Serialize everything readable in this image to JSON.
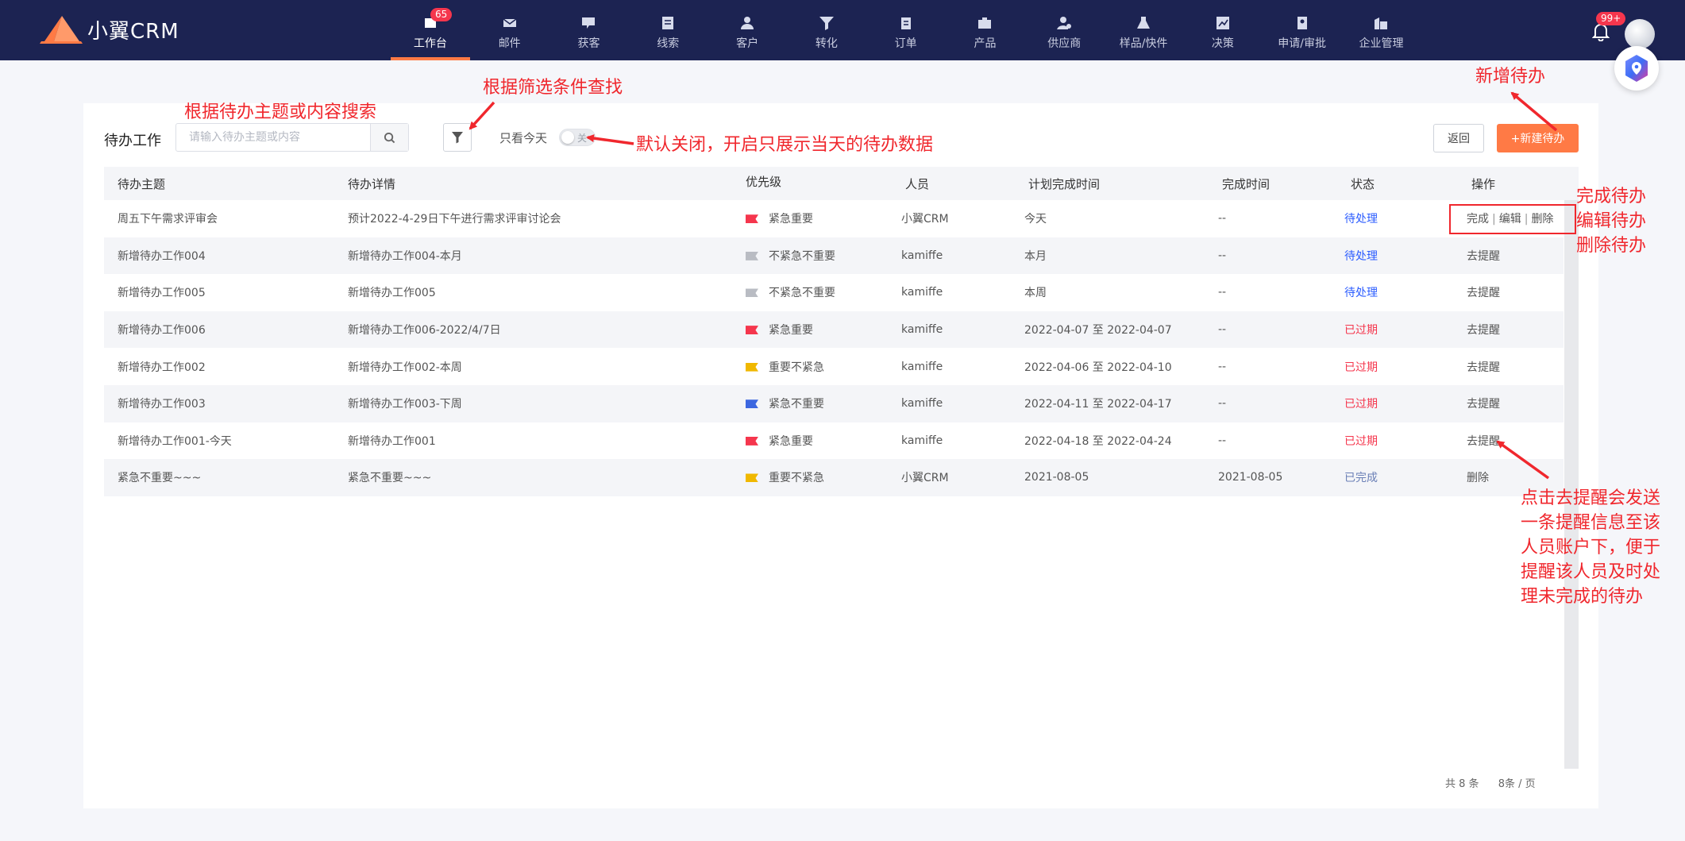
{
  "app": {
    "name": "小翼CRM"
  },
  "nav": {
    "items": [
      {
        "label": "工作台",
        "badge": "65",
        "icon": "workbench-icon",
        "active": true
      },
      {
        "label": "邮件",
        "icon": "mail-icon"
      },
      {
        "label": "获客",
        "icon": "acquire-icon"
      },
      {
        "label": "线索",
        "icon": "lead-icon"
      },
      {
        "label": "客户",
        "icon": "customer-icon"
      },
      {
        "label": "转化",
        "icon": "funnel-icon"
      },
      {
        "label": "订单",
        "icon": "order-icon"
      },
      {
        "label": "产品",
        "icon": "product-icon"
      },
      {
        "label": "供应商",
        "icon": "supplier-icon"
      },
      {
        "label": "样品/快件",
        "icon": "flask-icon"
      },
      {
        "label": "决策",
        "icon": "chart-icon"
      },
      {
        "label": "申请/审批",
        "icon": "approval-icon"
      },
      {
        "label": "企业管理",
        "icon": "building-icon"
      }
    ],
    "notification_badge": "99+"
  },
  "toolbar": {
    "title": "待办工作",
    "search_placeholder": "请输入待办主题或内容",
    "today_only_label": "只看今天",
    "toggle_text": "关",
    "back_label": "返回",
    "new_label": "+新建待办"
  },
  "table": {
    "columns": [
      "待办主题",
      "待办详情",
      "优先级",
      "人员",
      "计划完成时间",
      "完成时间",
      "状态",
      "操作"
    ],
    "rows": [
      {
        "subject": "周五下午需求评审会",
        "detail": "预计2022-4-29日下午进行需求评审讨论会",
        "priority": "紧急重要",
        "flag": "#f5364d",
        "person": "小翼CRM",
        "planned": "今天",
        "done_time": "--",
        "status": "待处理",
        "status_type": "pending",
        "ops": [
          "完成",
          "编辑",
          "删除"
        ]
      },
      {
        "subject": "新增待办工作004",
        "detail": "新增待办工作004-本月",
        "priority": "不紧急不重要",
        "flag": "#b9bcc3",
        "person": "kamiffe",
        "planned": "本月",
        "done_time": "--",
        "status": "待处理",
        "status_type": "pending",
        "ops": [
          "去提醒"
        ]
      },
      {
        "subject": "新增待办工作005",
        "detail": "新增待办工作005",
        "priority": "不紧急不重要",
        "flag": "#b9bcc3",
        "person": "kamiffe",
        "planned": "本周",
        "done_time": "--",
        "status": "待处理",
        "status_type": "pending",
        "ops": [
          "去提醒"
        ]
      },
      {
        "subject": "新增待办工作006",
        "detail": "新增待办工作006-2022/4/7日",
        "priority": "紧急重要",
        "flag": "#f5364d",
        "person": "kamiffe",
        "planned": "2022-04-07 至 2022-04-07",
        "done_time": "--",
        "status": "已过期",
        "status_type": "expired",
        "ops": [
          "去提醒"
        ]
      },
      {
        "subject": "新增待办工作002",
        "detail": "新增待办工作002-本周",
        "priority": "重要不紧急",
        "flag": "#f0b800",
        "person": "kamiffe",
        "planned": "2022-04-06 至 2022-04-10",
        "done_time": "--",
        "status": "已过期",
        "status_type": "expired",
        "ops": [
          "去提醒"
        ]
      },
      {
        "subject": "新增待办工作003",
        "detail": "新增待办工作003-下周",
        "priority": "紧急不重要",
        "flag": "#3c67e0",
        "person": "kamiffe",
        "planned": "2022-04-11 至 2022-04-17",
        "done_time": "--",
        "status": "已过期",
        "status_type": "expired",
        "ops": [
          "去提醒"
        ]
      },
      {
        "subject": "新增待办工作001-今天",
        "detail": "新增待办工作001",
        "priority": "紧急重要",
        "flag": "#f5364d",
        "person": "kamiffe",
        "planned": "2022-04-18 至 2022-04-24",
        "done_time": "--",
        "status": "已过期",
        "status_type": "expired",
        "ops": [
          "去提醒"
        ]
      },
      {
        "subject": "紧急不重要~~~",
        "detail": "紧急不重要~~~",
        "priority": "重要不紧急",
        "flag": "#f0b800",
        "person": "小翼CRM",
        "planned": "2021-08-05",
        "done_time": "2021-08-05",
        "status": "已完成",
        "status_type": "done",
        "ops": [
          "删除"
        ]
      }
    ]
  },
  "pagination": {
    "total": "共 8 条",
    "per_page": "8条 / 页"
  },
  "annotations": {
    "search": "根据待办主题或内容搜索",
    "filter": "根据筛选条件查找",
    "toggle": "默认关闭，开启只展示当天的待办数据",
    "new": "新增待办",
    "ops": [
      "完成待办",
      "编辑待办",
      "删除待办"
    ],
    "remind": [
      "点击去提醒会发送",
      "一条提醒信息至该",
      "人员账户下，便于",
      "提醒该人员及时处",
      "理未完成的待办"
    ]
  },
  "colors": {
    "nav_bg": "#1c2352",
    "accent": "#ff7a45",
    "annotation": "#f0272d"
  }
}
